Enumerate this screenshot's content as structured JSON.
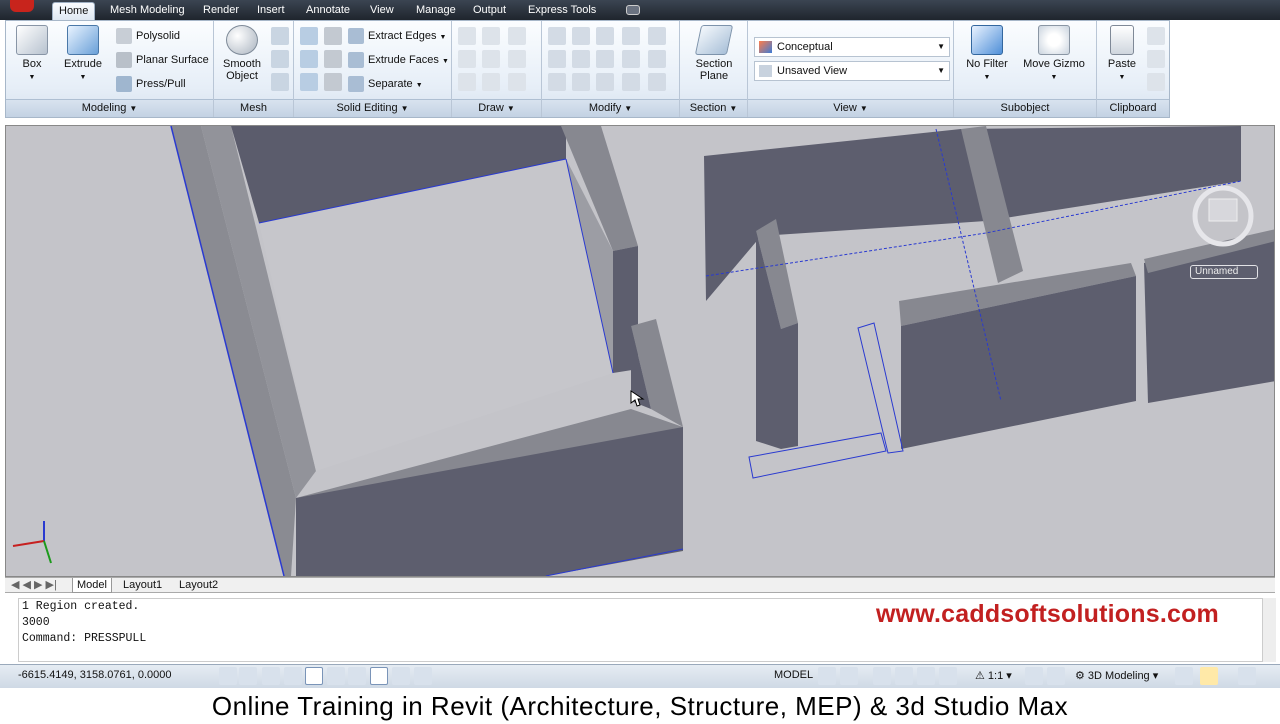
{
  "tabs": [
    "Home",
    "Mesh Modeling",
    "Render",
    "Insert",
    "Annotate",
    "View",
    "Manage",
    "Output",
    "Express Tools"
  ],
  "ribbon": {
    "modeling": {
      "title": "Modeling",
      "box": "Box",
      "extrude": "Extrude",
      "polysolid": "Polysolid",
      "planar": "Planar Surface",
      "presspull": "Press/Pull"
    },
    "mesh": {
      "title": "Mesh",
      "smooth1": "Smooth",
      "smooth2": "Object"
    },
    "solid_editing": {
      "title": "Solid Editing",
      "extract": "Extract Edges",
      "extrude_faces": "Extrude Faces",
      "separate": "Separate"
    },
    "draw": {
      "title": "Draw"
    },
    "modify": {
      "title": "Modify"
    },
    "section": {
      "title": "Section",
      "plane1": "Section",
      "plane2": "Plane"
    },
    "view": {
      "title": "View",
      "visual_style": "Conceptual",
      "saved_view": "Unsaved View"
    },
    "subobject": {
      "title": "Subobject",
      "filter": "No Filter",
      "gizmo": "Move Gizmo"
    },
    "clipboard": {
      "title": "Clipboard",
      "paste": "Paste"
    }
  },
  "viewcube": {
    "label": "Unnamed"
  },
  "layout_tabs": [
    "Model",
    "Layout1",
    "Layout2"
  ],
  "command_lines": [
    "1 Region created.",
    "3000",
    "Command:  PRESSPULL"
  ],
  "watermark": "www.caddsoftsolutions.com",
  "status": {
    "coords": "-6615.4149, 3158.0761, 0.0000",
    "model": "MODEL",
    "scale": "1:1",
    "workspace": "3D Modeling"
  },
  "caption": "Online Training in Revit (Architecture, Structure, MEP) & 3d Studio Max",
  "colors": {
    "wall_face": "#5d5e6e",
    "wall_top": "#87888f",
    "floor": "#c4c4c9",
    "accent_blue": "#2a3ad0",
    "brand_red": "#c22020"
  }
}
